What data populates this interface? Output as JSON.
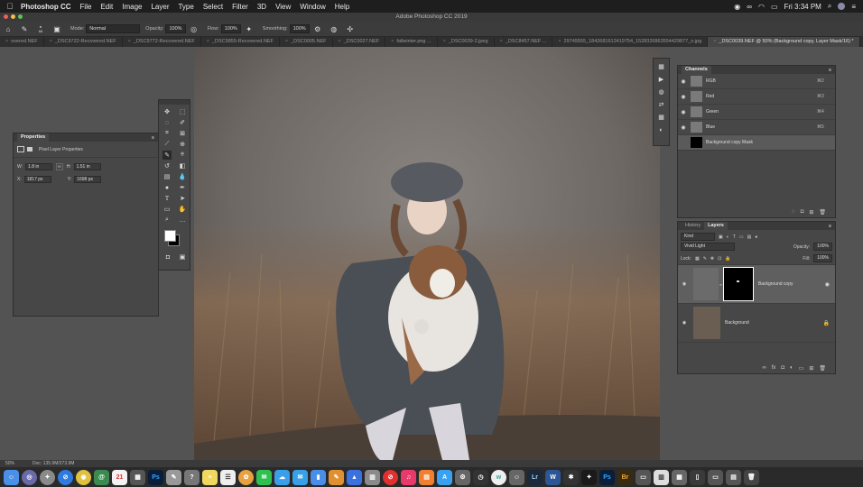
{
  "menubar": {
    "app_name": "Photoshop CC",
    "items": [
      "File",
      "Edit",
      "Image",
      "Layer",
      "Type",
      "Select",
      "Filter",
      "3D",
      "View",
      "Window",
      "Help"
    ],
    "clock": "Fri 3:34 PM"
  },
  "window_title": "Adobe Photoshop CC 2019",
  "options_bar": {
    "mode_label": "Mode:",
    "mode_value": "Normal",
    "opacity_label": "Opacity:",
    "opacity_value": "100%",
    "flow_label": "Flow:",
    "flow_value": "100%",
    "smoothing_label": "Smoothing:",
    "smoothing_value": "100%",
    "brush_size": "66"
  },
  "tabs": [
    {
      "label": "overed.NEF",
      "active": false
    },
    {
      "label": "_DSC9722-Recovered.NEF",
      "active": false
    },
    {
      "label": "_DSC9772-Recovered.NEF",
      "active": false
    },
    {
      "label": "_DSC9855-Recovered.NEF",
      "active": false
    },
    {
      "label": "_DSC0005.NEF",
      "active": false
    },
    {
      "label": "_DSC0027.NEF",
      "active": false
    },
    {
      "label": "fallwinter.png ...",
      "active": false
    },
    {
      "label": "_DSC0039-2.jpeg",
      "active": false
    },
    {
      "label": "_DSC8457.NEF ...",
      "active": false
    },
    {
      "label": "29749555_1842681612419754_1528326863554429877_o.jpg",
      "active": false
    },
    {
      "label": "_DSC0039.NEF @ 50% (Background copy, Layer Mask/16) *",
      "active": true
    }
  ],
  "properties": {
    "title": "Properties",
    "subtitle": "Pixel Layer Properties",
    "w_label": "W:",
    "w_value": "1.8 in",
    "h_label": "H:",
    "h_value": "1.51 in",
    "x_label": "X:",
    "x_value": "1817 px",
    "y_label": "Y:",
    "y_value": "1698 px"
  },
  "channels": {
    "title": "Channels",
    "rows": [
      {
        "name": "RGB",
        "shortcut": "⌘2"
      },
      {
        "name": "Red",
        "shortcut": "⌘3"
      },
      {
        "name": "Green",
        "shortcut": "⌘4"
      },
      {
        "name": "Blue",
        "shortcut": "⌘5"
      },
      {
        "name": "Background copy Mask",
        "shortcut": ""
      }
    ]
  },
  "layers": {
    "tab_history": "History",
    "tab_layers": "Layers",
    "filter_kind": "Kind",
    "blend_mode": "Vivid Light",
    "opacity_label": "Opacity:",
    "opacity_value": "100%",
    "lock_label": "Lock:",
    "fill_label": "Fill:",
    "fill_value": "100%",
    "rows": [
      {
        "name": "Background copy"
      },
      {
        "name": "Background"
      }
    ]
  },
  "status": {
    "zoom": "50%",
    "doc": "Doc: 135.9M/273.9M"
  },
  "colors": {
    "panel_bg": "#474747",
    "app_bg": "#535353",
    "accent_blue": "#2d6ed6"
  }
}
